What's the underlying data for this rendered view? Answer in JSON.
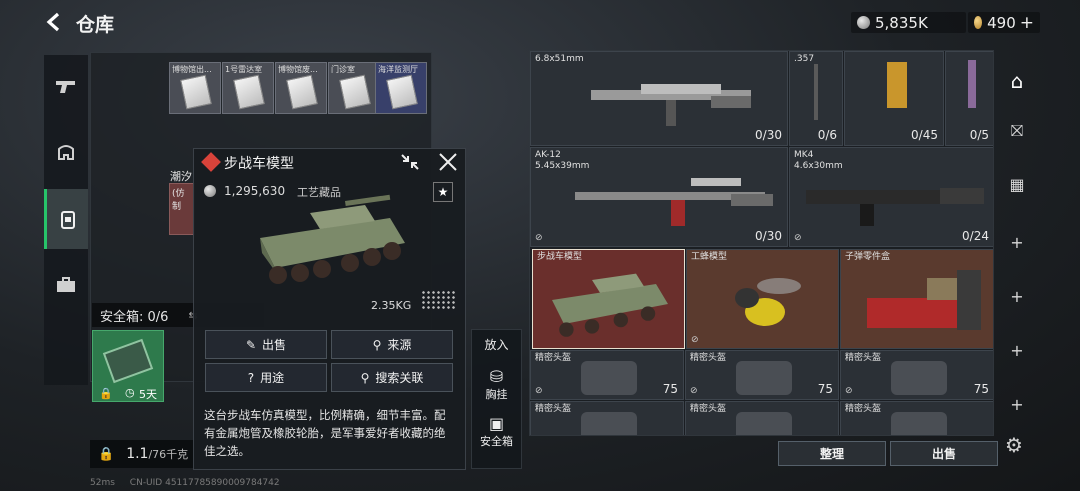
{
  "header": {
    "title": "仓库",
    "currency_silver": "5,835K",
    "currency_gold": "490",
    "plus": "+"
  },
  "left_panel": {
    "cards": [
      {
        "label": "博物馆出..."
      },
      {
        "label": "1号雷达室"
      },
      {
        "label": "博物馆废..."
      },
      {
        "label": "门诊室"
      },
      {
        "label": "海洋监测厅"
      }
    ],
    "row2_label": "潮汐",
    "row2_sub": "(仿制",
    "safe_box_label": "安全箱: 0/6",
    "safe_days": "5天",
    "capacity": "1.1",
    "capacity_unit": "/76千克",
    "net": "52ms",
    "uid": "CN-UID 45117785890009784742"
  },
  "popup": {
    "title": "步战车模型",
    "price": "1,295,630",
    "category": "工艺藏品",
    "weight": "2.35KG",
    "buttons": {
      "sell": "出售",
      "source": "来源",
      "usage": "用途",
      "search": "搜索关联"
    },
    "description": "这台步战车仿真模型，比例精确，细节丰富。配有金属炮管及橡胶轮胎，是军事爱好者收藏的绝佳之选。"
  },
  "side_col": {
    "place": "放入",
    "vest": "胸挂",
    "safe": "安全箱"
  },
  "warehouse": {
    "items": [
      {
        "name": "6.8x51mm",
        "count": "0/30"
      },
      {
        "name": ".357",
        "count": "0/6"
      },
      {
        "name": "",
        "count": "0/45"
      },
      {
        "name": "",
        "count": "0/5"
      },
      {
        "name": "AK-12\n5.45x39mm",
        "count": "0/30"
      },
      {
        "name": "MK4\n4.6x30mm",
        "count": "0/24"
      },
      {
        "name": "步战车模型",
        "count": ""
      },
      {
        "name": "工蜂模型",
        "count": ""
      },
      {
        "name": "子弹零件盒",
        "count": ""
      },
      {
        "name": "精密头盔",
        "count": "75"
      },
      {
        "name": "精密头盔",
        "count": "75"
      },
      {
        "name": "精密头盔",
        "count": "75"
      },
      {
        "name": "精密头盔",
        "count": ""
      },
      {
        "name": "精密头盔",
        "count": ""
      },
      {
        "name": "精密头盔",
        "count": ""
      }
    ],
    "sort_button": "整理",
    "sell_button": "出售"
  },
  "colors": {
    "accent_green": "#27c46a",
    "selected_bg": "#6a2f2c",
    "brown_bg": "#5a3a2e"
  }
}
